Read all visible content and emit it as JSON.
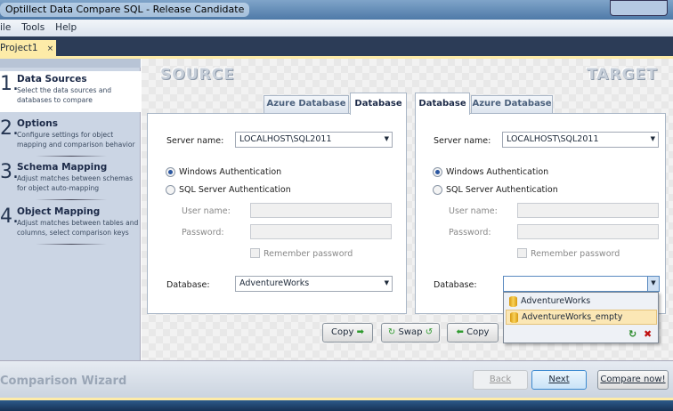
{
  "window": {
    "title": "Optillect Data Compare SQL - Release Candidate"
  },
  "menu": [
    "ile",
    "Tools",
    "Help"
  ],
  "doc_tab": {
    "label": "Project1",
    "close": "×"
  },
  "steps": [
    {
      "num": "1.",
      "title": "Data Sources",
      "desc": "Select the data sources and databases to compare"
    },
    {
      "num": "2.",
      "title": "Options",
      "desc": "Configure settings for object mapping and comparison behavior"
    },
    {
      "num": "3.",
      "title": "Schema Mapping",
      "desc": "Adjust matches between schemas for object auto-mapping"
    },
    {
      "num": "4.",
      "title": "Object Mapping",
      "desc": "Adjust matches between tables and columns, select comparison keys"
    }
  ],
  "source": {
    "heading": "SOURCE",
    "tabs": [
      "Azure Database",
      "Database"
    ],
    "server_label": "Server name:",
    "server": "LOCALHOST\\SQL2011",
    "win_auth": "Windows Authentication",
    "sql_auth": "SQL Server Authentication",
    "user_label": "User name:",
    "password_label": "Password:",
    "remember": "Remember password",
    "db_label": "Database:",
    "database": "AdventureWorks"
  },
  "target": {
    "heading": "TARGET",
    "tabs": [
      "Database",
      "Azure Database"
    ],
    "server_label": "Server name:",
    "server": "LOCALHOST\\SQL2011",
    "win_auth": "Windows Authentication",
    "sql_auth": "SQL Server Authentication",
    "user_label": "User name:",
    "password_label": "Password:",
    "remember": "Remember password",
    "db_label": "Database:",
    "database": "",
    "options": [
      "AdventureWorks",
      "AdventureWorks_empty"
    ]
  },
  "actions": {
    "copy_right": "Copy",
    "swap": "Swap",
    "copy_left": "Copy"
  },
  "footer": {
    "title": "Comparison Wizard",
    "back": "Back",
    "next": "Next",
    "compare": "Compare now!"
  }
}
